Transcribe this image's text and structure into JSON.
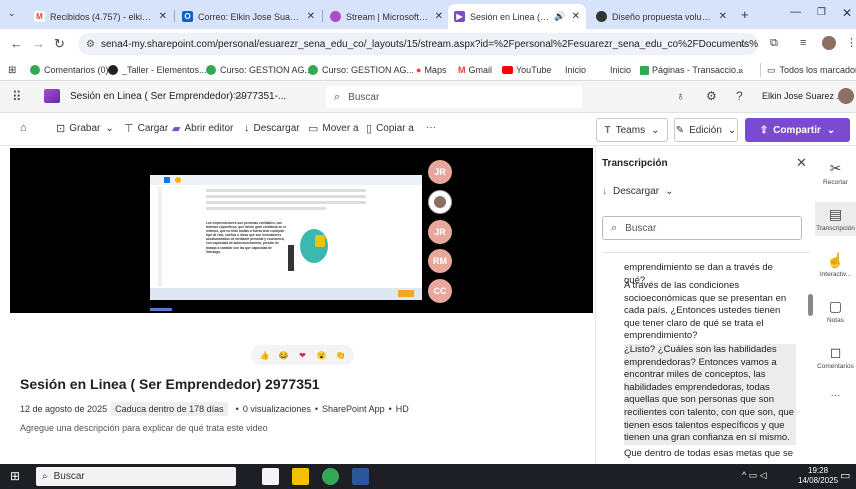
{
  "browser": {
    "tabs": [
      {
        "label": "Recibidos (4.757) - elkin081",
        "icon_color": "#ea4335"
      },
      {
        "label": "Correo: Elkin Jose Suarez Ra",
        "icon_color": "#0a64c8"
      },
      {
        "label": "Stream | Microsoft 365 Cop",
        "icon_color": "#b24ac6"
      },
      {
        "label": "Sesión en Linea ( Ser Em",
        "icon_color": "#7a4bd0"
      },
      {
        "label": "Diseño propuesta voluntaria",
        "icon_color": "#333"
      }
    ],
    "new_tab": "+",
    "url": "sena4-my.sharepoint.com/personal/esuarezr_sena_edu_co/_layouts/15/stream.aspx?id=%2Fpersonal%2Fesuarezr_sena_edu_co%2FDocuments%2FRecordings...",
    "bookmarks": [
      {
        "label": "Comentarios (0)",
        "color": "#34a853"
      },
      {
        "label": "_Taller - Elementos...",
        "color": "#222"
      },
      {
        "label": "Curso: GESTION AG...",
        "color": "#34a853"
      },
      {
        "label": "Curso: GESTION AG...",
        "color": "#34a853"
      },
      {
        "label": "Maps",
        "color": "#fbbc05"
      },
      {
        "label": "Gmail",
        "color": "#ea4335"
      },
      {
        "label": "YouTube",
        "color": "#ff0000"
      },
      {
        "label": "Inicio",
        "color": ""
      },
      {
        "label": "Inicio",
        "color": ""
      },
      {
        "label": "Páginas - Transaccio...",
        "color": "#34a853"
      }
    ],
    "bookmarks_more": "»",
    "all_bookmarks": "Todos los marcadores"
  },
  "sharepoint": {
    "doc_title": "Sesión en Linea ( Ser Emprendedor) 2977351-...",
    "search_placeholder": "Buscar",
    "user_name": "Elkin Jose Suarez ..."
  },
  "commands": {
    "record": "Grabar",
    "upload": "Cargar",
    "open_editor": "Abrir editor",
    "download": "Descargar",
    "move_to": "Mover a",
    "copy_to": "Copiar a",
    "more": "···",
    "teams": "Teams",
    "edit": "Edición",
    "share": "Compartir"
  },
  "video": {
    "participants": [
      "JR",
      "",
      "JR",
      "RM",
      "CC"
    ],
    "participant_colors": [
      "#e8a79b",
      "#888",
      "#e8a79b",
      "#e8a79b",
      "#e8a79b"
    ],
    "slide_text": "Los emprendedores son personas confiables, con talentos específicos, que tienen gran confianza en sí mismos, que no tiran toallas a fuerza ante cualquier tipo de reto, sueños o ideas que son innovadores acostumbrados de mediante personal y económica, con capacidad de autoconocimiento, presión de trabajo a cambiar con las que capacidad de liderazgo."
  },
  "reactions": [
    "👍",
    "😂",
    "❤",
    "😮",
    "👏"
  ],
  "info": {
    "title": "Sesión en Linea ( Ser Emprendedor) 2977351",
    "date": "12 de agosto de 2025",
    "expires": "Caduca dentro de 178 días",
    "views": "0 visualizaciones",
    "app": "SharePoint App",
    "quality": "HD",
    "separator": "•",
    "description_placeholder": "Agregue una descripción para explicar de qué trata este video"
  },
  "transcript": {
    "title": "Transcripción",
    "download": "Descargar",
    "search_placeholder": "Buscar",
    "blocks": [
      "emprendimiento se dan a través de qué?",
      "A través de las condiciones socioeconómicas que se presentan en cada país. ¿Entonces ustedes tienen que tener claro de qué se trata el emprendimiento?",
      "¿Listo? ¿Cuáles son las habilidades emprendedoras? Entonces vamos a encontrar miles de conceptos, las habilidades emprendedoras, todas aquellas que son personas que son recilientes con talento, con que son, que tienen esos talentos específicos y que tienen una gran confianza en sí mismo.",
      "Que dentro de todas esas metas que se"
    ]
  },
  "rail": {
    "items": [
      "Recortar",
      "Transcripción",
      "Interactiv...",
      "Notas",
      "Comentarios"
    ],
    "more": "···"
  },
  "taskbar": {
    "search_placeholder": "Buscar",
    "time": "19:28",
    "date": "14/08/2025"
  }
}
